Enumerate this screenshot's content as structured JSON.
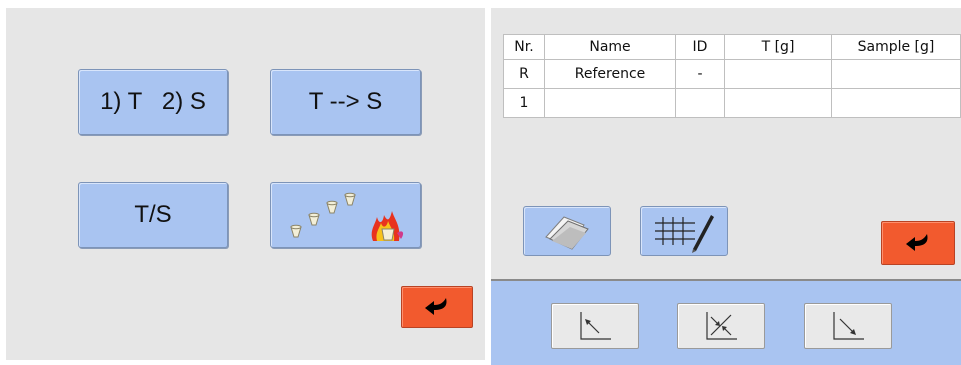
{
  "left": {
    "btn_t_then_s": "1) T   2) S",
    "btn_t_to_s": "T --> S",
    "btn_t_slash_s": "T/S",
    "btn_burn_icon": "crucibles-fire-icon",
    "back_icon": "return-arrow-icon"
  },
  "table": {
    "headers": [
      "Nr.",
      "Name",
      "ID",
      "T [g]",
      "Sample [g]"
    ],
    "rows": [
      [
        "R",
        "Reference",
        "-",
        "",
        ""
      ],
      [
        "1",
        "",
        "",
        "",
        ""
      ]
    ]
  },
  "right": {
    "folder_icon": "folder-icon",
    "grid_edit_icon": "grid-edit-icon",
    "back_icon": "return-arrow-icon"
  },
  "bottom": {
    "icons": [
      "axis-arrow-upleft-icon",
      "axis-arrows-converge-icon",
      "axis-arrow-downright-icon"
    ]
  },
  "colors": {
    "button_blue": "#a9c4f1",
    "back_orange": "#f25a2e",
    "panel_gray": "#e6e6e6"
  }
}
